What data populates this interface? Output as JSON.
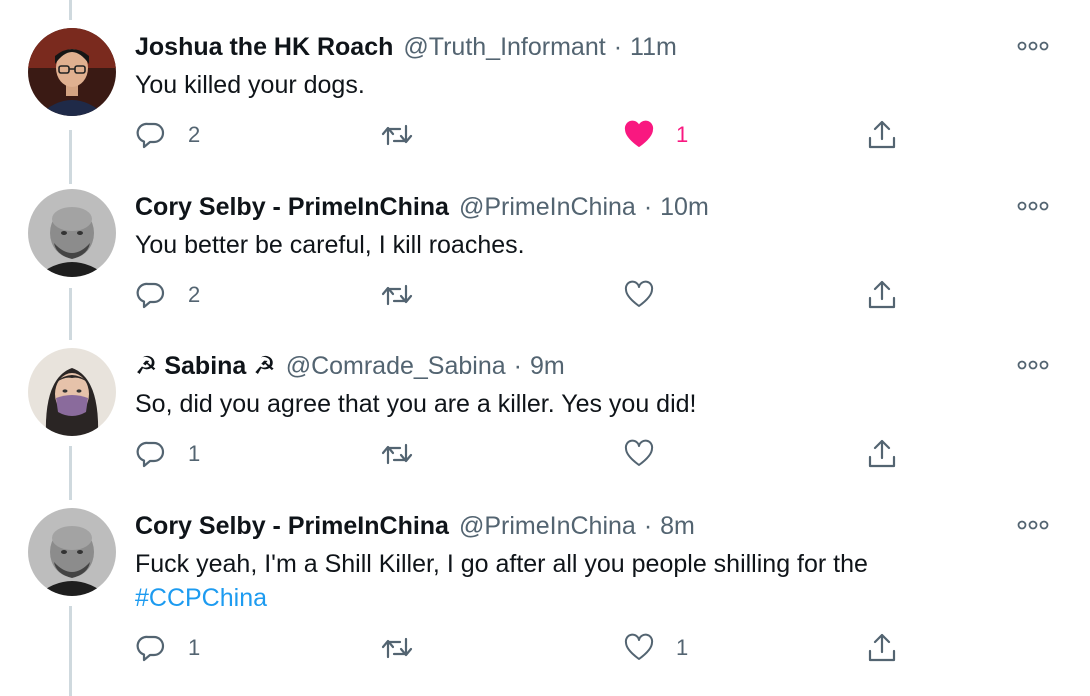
{
  "tweets": [
    {
      "display_name": "Joshua the HK Roach",
      "handle": "@Truth_Informant",
      "separator": "·",
      "time": "11m",
      "text": "You killed your dogs.",
      "hashtag": "",
      "reply_count": "2",
      "retweet_count": "",
      "like_count": "1",
      "liked": true,
      "avatar": "avatar-young-man-glasses"
    },
    {
      "display_name": "Cory Selby - PrimeInChina",
      "handle": "@PrimeInChina",
      "separator": "·",
      "time": "10m",
      "text": "You better be careful, I kill roaches.",
      "hashtag": "",
      "reply_count": "2",
      "retweet_count": "",
      "like_count": "",
      "liked": false,
      "avatar": "avatar-bald-man-grayscale"
    },
    {
      "display_name": "☭ Sabina ☭",
      "handle": "@Comrade_Sabina",
      "separator": "·",
      "time": "9m",
      "text": "So, did you agree that you are a killer. Yes you did!",
      "hashtag": "",
      "reply_count": "1",
      "retweet_count": "",
      "like_count": "",
      "liked": false,
      "avatar": "avatar-woman-purple-mask"
    },
    {
      "display_name": "Cory Selby - PrimeInChina",
      "handle": "@PrimeInChina",
      "separator": "·",
      "time": "8m",
      "text": "Fuck yeah, I'm a Shill Killer, I go after all you people shilling for the",
      "hashtag": "#CCPChina",
      "reply_count": "1",
      "retweet_count": "",
      "like_count": "1",
      "liked": false,
      "avatar": "avatar-bald-man-grayscale"
    }
  ],
  "colors": {
    "text_primary": "#0f1419",
    "text_secondary": "#536471",
    "hashtag": "#1d9bf0",
    "like_active": "#f91880",
    "thread_line": "#cfd9de",
    "icon": "#536471"
  },
  "icons": [
    "reply-icon",
    "retweet-icon",
    "like-icon",
    "share-icon",
    "more-options-icon"
  ]
}
